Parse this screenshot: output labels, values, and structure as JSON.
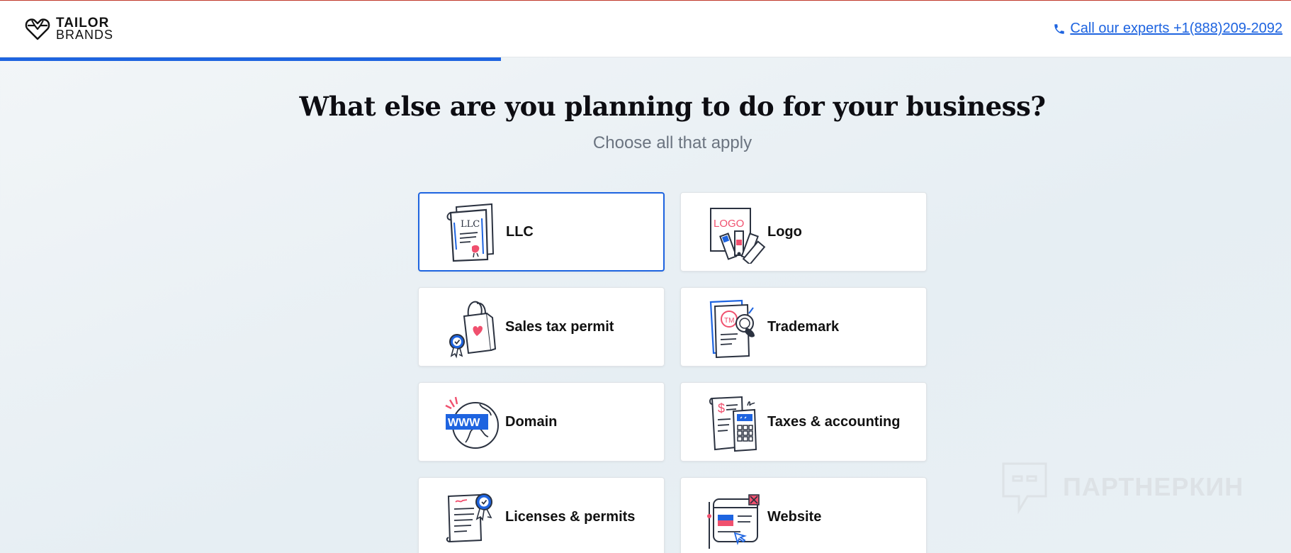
{
  "header": {
    "logo_line1": "TAILOR",
    "logo_line2": "BRANDS",
    "call_label": "Call our experts +1(888)209-2092",
    "progress_fraction": 0.388
  },
  "main": {
    "title": "What else are you planning to do for your business?",
    "subtitle": "Choose all that apply"
  },
  "options": [
    {
      "label": "LLC",
      "icon": "llc-certificate-icon",
      "selected": true
    },
    {
      "label": "Logo",
      "icon": "logo-swatches-icon",
      "selected": false
    },
    {
      "label": "Sales tax permit",
      "icon": "shopping-bag-icon",
      "selected": false
    },
    {
      "label": "Trademark",
      "icon": "trademark-stamp-icon",
      "selected": false
    },
    {
      "label": "Domain",
      "icon": "www-globe-icon",
      "selected": false
    },
    {
      "label": "Taxes & accounting",
      "icon": "calculator-receipt-icon",
      "selected": false
    },
    {
      "label": "Licenses & permits",
      "icon": "license-document-icon",
      "selected": false
    },
    {
      "label": "Website",
      "icon": "website-browser-icon",
      "selected": false
    }
  ],
  "watermark": {
    "text": "ПАРТНЕРКИН"
  },
  "colors": {
    "accent": "#1e64e0",
    "pink": "#f0506e",
    "ink": "#2b3240"
  }
}
